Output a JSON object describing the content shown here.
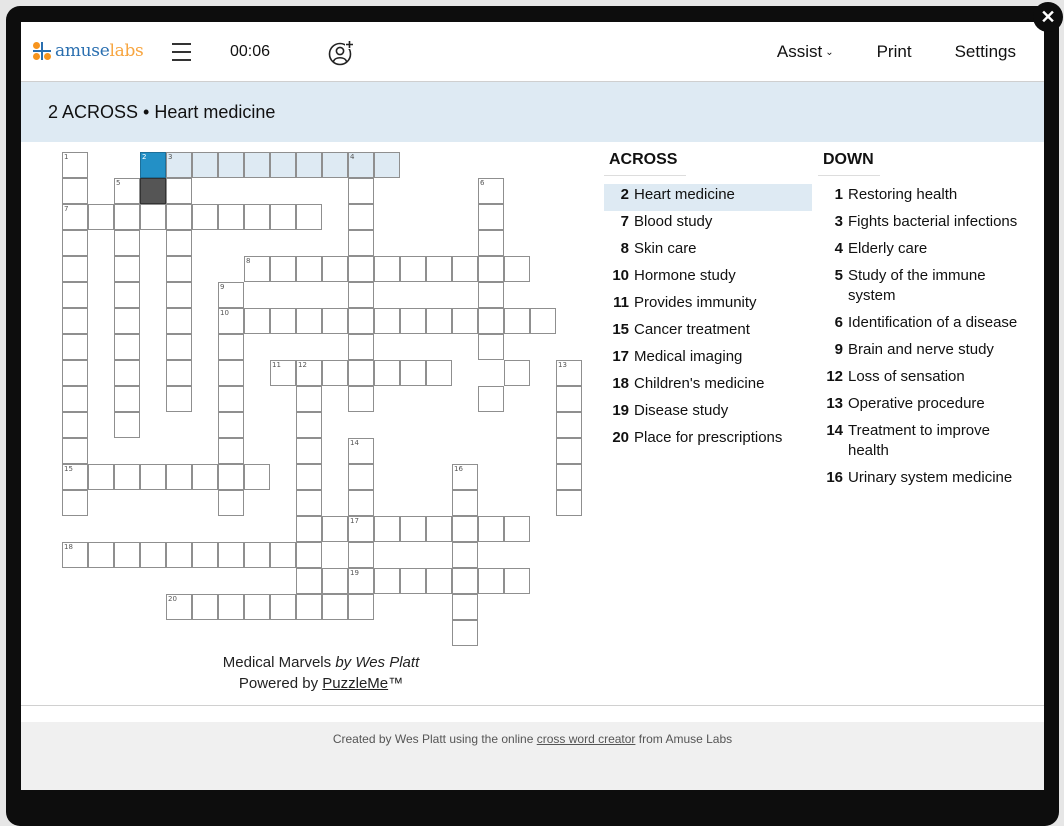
{
  "window": {
    "close_icon": "✕"
  },
  "topbar": {
    "logo": {
      "part1": "amuse",
      "part2": "labs"
    },
    "timer": "00:06",
    "nav": [
      {
        "label": "Assist",
        "has_dropdown": true,
        "chevron": "⌄"
      },
      {
        "label": "Print"
      },
      {
        "label": "Settings"
      }
    ]
  },
  "current_clue": {
    "text": "2 ACROSS • Heart medicine"
  },
  "grid": {
    "cols": 20,
    "rows": [
      "#  ..........       ",
      ". .X.      .    .   ",
      ".......... .    .   ",
      ". . .      .    .   ",
      ". . .  ...........  ",
      ". . . .    .    .   ",
      ". . . ............. ",
      ". . . .    .    .   ",
      ". . . . .......  . .",
      ". . . .  . .    .  .",
      ". .   .  .         .",
      ".     .  . .       .",
      "........ . .   .   .",
      ".     .  . .   .   .",
      "         .........  ",
      ".......... .   .    ",
      "         .........  ",
      "    ........   .    ",
      "               .    "
    ],
    "numbers": [
      {
        "r": 0,
        "c": 0,
        "n": 1
      },
      {
        "r": 0,
        "c": 3,
        "n": 2
      },
      {
        "r": 0,
        "c": 4,
        "n": 3
      },
      {
        "r": 0,
        "c": 11,
        "n": 4
      },
      {
        "r": 1,
        "c": 2,
        "n": 5
      },
      {
        "r": 1,
        "c": 16,
        "n": 6
      },
      {
        "r": 2,
        "c": 0,
        "n": 7
      },
      {
        "r": 4,
        "c": 7,
        "n": 8
      },
      {
        "r": 5,
        "c": 6,
        "n": 9
      },
      {
        "r": 6,
        "c": 6,
        "n": 10
      },
      {
        "r": 8,
        "c": 8,
        "n": 11
      },
      {
        "r": 8,
        "c": 9,
        "n": 12
      },
      {
        "r": 8,
        "c": 19,
        "n": 13
      },
      {
        "r": 11,
        "c": 11,
        "n": 14
      },
      {
        "r": 12,
        "c": 0,
        "n": 15
      },
      {
        "r": 12,
        "c": 15,
        "n": 16
      },
      {
        "r": 14,
        "c": 11,
        "n": 17
      },
      {
        "r": 15,
        "c": 0,
        "n": 18
      },
      {
        "r": 16,
        "c": 11,
        "n": 19
      },
      {
        "r": 17,
        "c": 4,
        "n": 20
      }
    ],
    "selected": {
      "r": 0,
      "c": 3
    },
    "highlight_word": {
      "row": 0,
      "from": 3,
      "to": 12
    }
  },
  "credits": {
    "title": "Medical Marvels",
    "byline": "by Wes Platt",
    "powered_prefix": "Powered by",
    "powered_link": "PuzzleMe",
    "tm": "™"
  },
  "clues": {
    "across_heading": "ACROSS",
    "down_heading": "DOWN",
    "across": [
      {
        "num": "2",
        "text": "Heart medicine",
        "active": true
      },
      {
        "num": "7",
        "text": "Blood study"
      },
      {
        "num": "8",
        "text": "Skin care"
      },
      {
        "num": "10",
        "text": "Hormone study"
      },
      {
        "num": "11",
        "text": "Provides immunity"
      },
      {
        "num": "15",
        "text": "Cancer treatment"
      },
      {
        "num": "17",
        "text": "Medical imaging"
      },
      {
        "num": "18",
        "text": "Children's medicine"
      },
      {
        "num": "19",
        "text": "Disease study"
      },
      {
        "num": "20",
        "text": "Place for prescriptions"
      }
    ],
    "down": [
      {
        "num": "1",
        "text": "Restoring health"
      },
      {
        "num": "3",
        "text": "Fights bacterial infections"
      },
      {
        "num": "4",
        "text": "Elderly care"
      },
      {
        "num": "5",
        "text": "Study of the immune system"
      },
      {
        "num": "6",
        "text": "Identification of a disease"
      },
      {
        "num": "9",
        "text": "Brain and nerve study"
      },
      {
        "num": "12",
        "text": "Loss of sensation"
      },
      {
        "num": "13",
        "text": "Operative procedure"
      },
      {
        "num": "14",
        "text": "Treatment to improve health"
      },
      {
        "num": "16",
        "text": "Urinary system medicine"
      }
    ]
  },
  "footer": {
    "prefix": "Created by Wes Platt using the online",
    "link": "cross word creator",
    "suffix": "from Amuse Labs"
  },
  "colors": {
    "accent_selected": "#2390c6",
    "word_highlight": "#deeaf3",
    "logo_blue": "#2a6fb0",
    "logo_orange": "#f7a540"
  }
}
